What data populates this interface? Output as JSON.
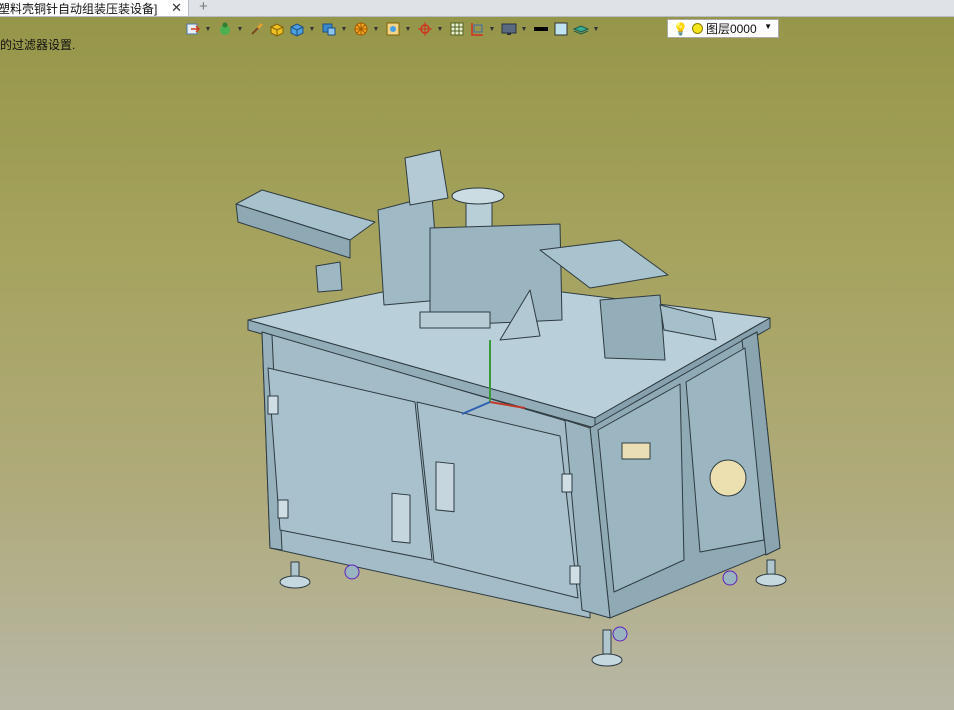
{
  "tab": {
    "title": "塑料壳铜针自动组装压装设备]",
    "close_glyph": "✕",
    "add_glyph": "+"
  },
  "status": {
    "hint": "的过滤器设置."
  },
  "layer": {
    "bulb_glyph": "💡",
    "name": "图层0000",
    "arrow_glyph": "▼"
  },
  "toolbar": {
    "tools": [
      {
        "name": "import-icon",
        "dropdown": true
      },
      {
        "name": "material-icon",
        "dropdown": true
      },
      {
        "name": "paint-brush-icon",
        "dropdown": false
      },
      {
        "name": "solid-box-icon",
        "dropdown": false
      },
      {
        "name": "view-cube-icon",
        "dropdown": true
      },
      {
        "name": "view-layout-icon",
        "dropdown": true
      },
      {
        "name": "render-wheel-icon",
        "dropdown": true
      },
      {
        "name": "snap-icon",
        "dropdown": true
      },
      {
        "name": "coordinate-icon",
        "dropdown": true
      },
      {
        "name": "grid-icon",
        "dropdown": false
      },
      {
        "name": "frame-icon",
        "dropdown": true
      },
      {
        "name": "monitor-icon",
        "dropdown": true
      },
      {
        "name": "line-weight-icon",
        "dropdown": false
      },
      {
        "name": "color-swatch-icon",
        "dropdown": false
      },
      {
        "name": "layer-stack-icon",
        "dropdown": true
      }
    ]
  },
  "colors": {
    "machine": "#a9c3ce",
    "edge": "#2e3b42",
    "accent_red": "#c0392b",
    "accent_blue": "#2f5fb0"
  }
}
